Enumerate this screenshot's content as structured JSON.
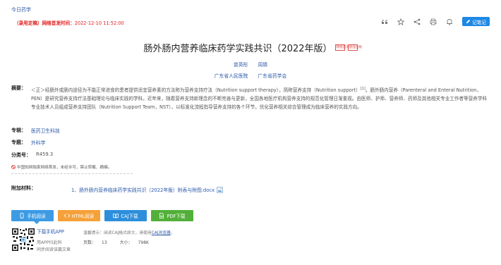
{
  "header": {
    "journal": "今日药学",
    "pub_prefix": "（录用定稿）",
    "pub_label": "网络首发时间：",
    "pub_time": "2022-12-10 11:52:00",
    "note_label": "记笔记"
  },
  "article": {
    "title": "肠外肠内营养临床药学实践共识（2022年版）",
    "badge_network": "网络首发",
    "badge_edition": "增强出版",
    "authors": [
      "曾英彤",
      "周婧"
    ],
    "orgs": [
      "广东省人民医院",
      "广东省药学会"
    ],
    "abstract_label": "摘要：",
    "abstract_a": "＜正＞经肠外或肠内途径为不能正常进食的患者提供适宜营养素的方法称为营养支持疗法（Nutrition support therapy），简称营养支持（Nutrition support）",
    "abstract_ref": "[1]",
    "abstract_b": "。肠外肠内营养（Parenteral and Enteral Nutrition，PEN）是研究营养支持疗法基础理论与临床实践的学科。近年来，随着营养支持新理念的不断完善与更新，全国各地医疗机构营养支持的规范化管理日渐重视。由医师、护师、营养师、药师及其他相关专业工作者等营养学科专业技术人员组成营养支持团队（Nutrition Support Team，NST），以标准化流程指导营养支持的各个环节，优化营养相关综合管理成为临床营养的实践方向。",
    "series_label": "专辑：",
    "series": "医药卫生科技",
    "topic_label": "专题：",
    "topic": "外科学",
    "class_label": "分类号：",
    "class_no": "R459.3",
    "copyright": "中国知网独家网络首发，未经许可，禁止转载、摘编。"
  },
  "attachments": {
    "label": "附加材料：",
    "file": "1、肠外肠内营养临床药学实践共识（2022年版）附表与附图.docx"
  },
  "downloads": {
    "mobile": "手机阅读",
    "html": "HTML阅读",
    "caj": "CAJ下载",
    "pdf": "PDF下载"
  },
  "app": {
    "title": "下载手机APP",
    "sub1": "用APP扫此码",
    "sub2": "同步阅读该篇文章"
  },
  "tip": {
    "text": "温馨提示：阅读CAJ格式原文，请使用",
    "link": "CAJ浏览器",
    "end": "。"
  },
  "pageinfo": {
    "pages_label": "页数：",
    "pages": "13",
    "size_label": "大小：",
    "size": "798K"
  },
  "colors": {
    "accent": "#1e88e5",
    "link": "#2b58a8",
    "warning": "#e02020",
    "html_btn": "#f5a13a",
    "pdf_btn": "#52b03a"
  }
}
